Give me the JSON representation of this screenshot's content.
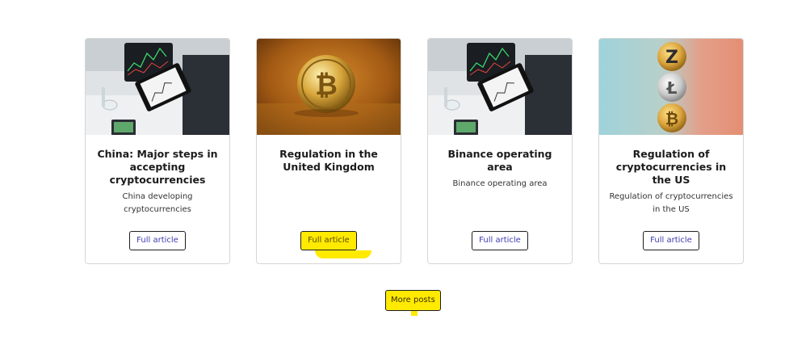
{
  "posts": [
    {
      "title": "China: Major steps in accepting cryptocurrencies",
      "excerpt": "China developing cryptocurrencies",
      "button_label": "Full article",
      "image": "tablet-trading-chart"
    },
    {
      "title": "Regulation in the United Kingdom",
      "excerpt": "",
      "button_label": "Full article",
      "image": "bitcoin-gold-coin"
    },
    {
      "title": "Binance operating area",
      "excerpt": "Binance operating area",
      "button_label": "Full article",
      "image": "tablet-trading-chart"
    },
    {
      "title": "Regulation of cryptocurrencies in the US",
      "excerpt": "Regulation of cryptocurrencies in the US",
      "button_label": "Full article",
      "image": "stacked-crypto-coins"
    }
  ],
  "more_posts_label": "More posts",
  "colors": {
    "highlight": "#ffea00",
    "link": "#3b3bb0",
    "border": "#d6d6d6"
  }
}
